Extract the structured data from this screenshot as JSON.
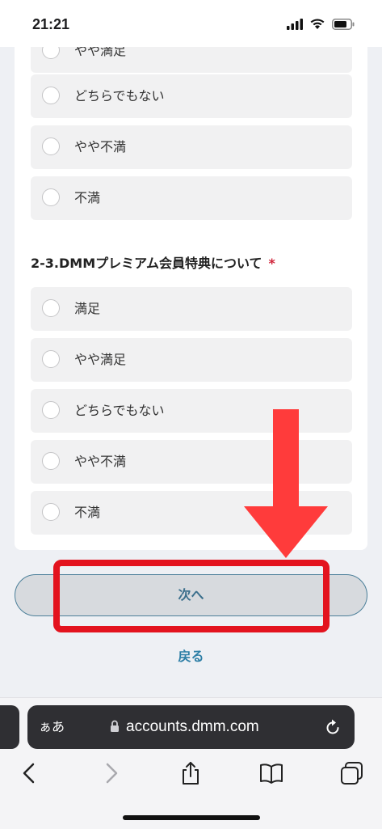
{
  "status": {
    "time": "21:21"
  },
  "previous_question_options": [
    "やや満足",
    "どちらでもない",
    "やや不満",
    "不満"
  ],
  "question": {
    "title": "2-3.DMMプレミアム会員特典について",
    "required_mark": "*",
    "options": [
      "満足",
      "やや満足",
      "どちらでもない",
      "やや不満",
      "不満"
    ]
  },
  "actions": {
    "next_label": "次へ",
    "back_label": "戻る"
  },
  "browser": {
    "aa_label": "ぁあ",
    "url": "accounts.dmm.com"
  },
  "annotation": {
    "arrow_color": "#ff3b3b",
    "box_color": "#e3131e"
  },
  "icons": [
    "lock-icon",
    "reload-icon",
    "back-icon",
    "forward-icon",
    "share-icon",
    "bookmarks-icon",
    "tabs-icon",
    "signal-icon",
    "wifi-icon",
    "battery-icon"
  ]
}
